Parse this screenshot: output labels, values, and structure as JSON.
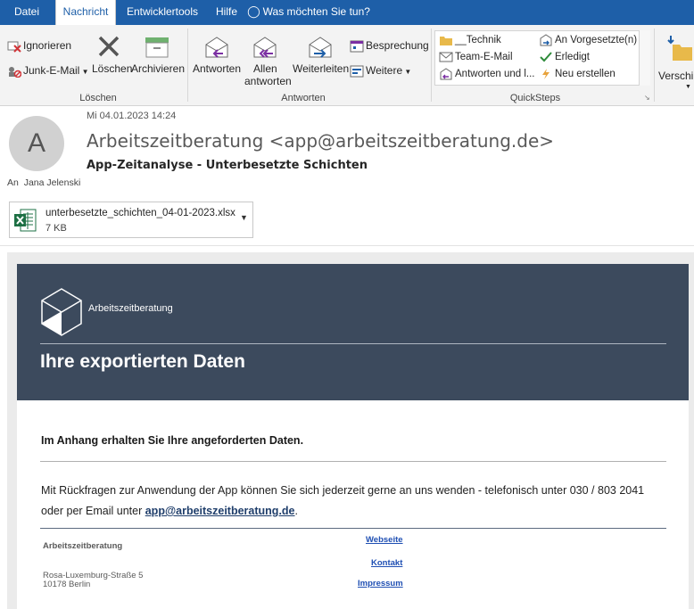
{
  "tabs": [
    "Datei",
    "Nachricht",
    "Entwicklertools",
    "Hilfe",
    "Was möchten Sie tun?"
  ],
  "ribbon": {
    "loeschen": {
      "ignore": "Ignorieren",
      "junk": "Junk-E-Mail",
      "delete": "Löschen",
      "archive": "Archivieren",
      "group": "Löschen"
    },
    "antworten": {
      "reply": "Antworten",
      "reply_all_1": "Allen",
      "reply_all_2": "antworten",
      "forward": "Weiterleiten",
      "meeting": "Besprechung",
      "more": "Weitere",
      "group": "Antworten"
    },
    "quicksteps": {
      "items": [
        "__Technik",
        "Team-E-Mail",
        "Antworten und l...",
        "An Vorgesetzte(n)",
        "Erledigt",
        "Neu erstellen"
      ],
      "group": "QuickSteps"
    },
    "move": "Verschi"
  },
  "message": {
    "avatar_letter": "A",
    "date": "Mi 04.01.2023 14:24",
    "sender": "Arbeitszeitberatung <app@arbeitszeitberatung.de>",
    "subject": "App-Zeitanalyse - Unterbesetzte Schichten",
    "to_label": "An",
    "to_name": "Jana Jelenski"
  },
  "attachment": {
    "name": "unterbesetzte_schichten_04-01-2023.xlsx",
    "size": "7 KB"
  },
  "body": {
    "brand": "Arbeitszeitberatung",
    "title": "Ihre exportierten Daten",
    "intro": "Im Anhang erhalten Sie Ihre angeforderten Daten.",
    "para1": "Mit Rückfragen zur Anwendung der App können Sie sich jederzeit gerne an uns wenden - telefonisch unter 030 / 803 2041",
    "para2_prefix": "oder per Email unter ",
    "para2_link": "app@arbeitszeitberatung.de",
    "para2_suffix": ".",
    "footer": {
      "company": "Arbeitszeitberatung",
      "addr1": "Rosa-Luxemburg-Straße 5",
      "addr2": "10178 Berlin",
      "links": [
        "Webseite",
        "Kontakt",
        "Impressum"
      ]
    }
  },
  "colors": {
    "tabbar": "#1e5fa8",
    "banner": "#3c4a5d",
    "link": "#1f4fb3"
  }
}
